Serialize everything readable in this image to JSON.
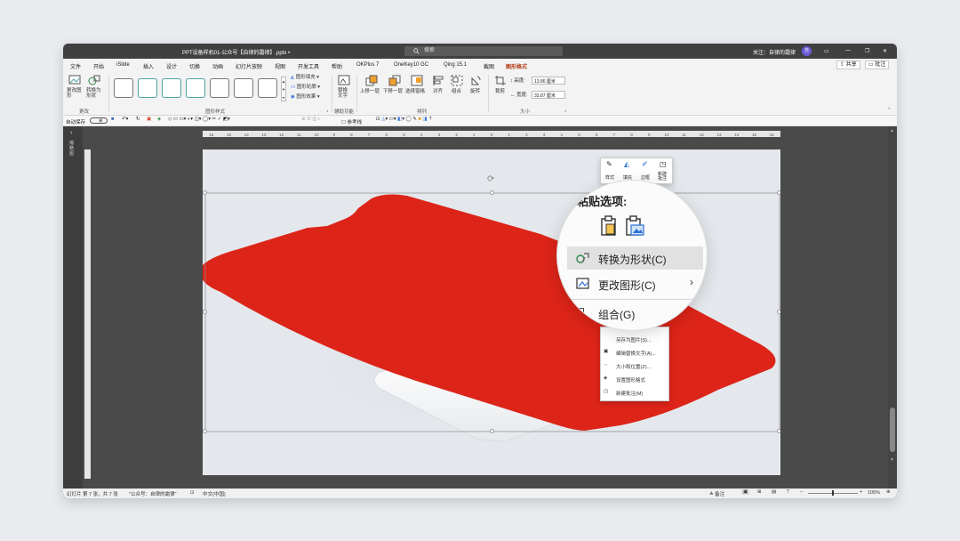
{
  "window": {
    "title": "PPT设备样机01-公众号【自律的霜律】.pptx  •",
    "search_placeholder": "搜索",
    "follow_text": "关注：自律的霜律",
    "avatar_text": "自"
  },
  "menu": {
    "items": [
      "文件",
      "开始",
      "iSlide",
      "插入",
      "设计",
      "切换",
      "动画",
      "幻灯片放映",
      "视图",
      "开发工具",
      "帮助",
      "OKPlus 7",
      "OneKey10 GC",
      "Qing 15.1",
      "截图",
      "图形格式"
    ],
    "share_label": "共享",
    "comment_label": "批注"
  },
  "ribbon": {
    "insert_group": {
      "btn1": "更改图形",
      "btn2": "转换为形状",
      "label": "更改"
    },
    "styles_group": {
      "fill": "图形填充",
      "outline": "图形轮廓",
      "effect": "图形效果",
      "label": "图形样式"
    },
    "access_group": {
      "alt_text": "替换文字",
      "label": "辅助功能"
    },
    "arrange_group": {
      "forward": "上移一层",
      "backward": "下移一层",
      "pane": "选择窗格",
      "align": "对齐",
      "group": "组合",
      "rotate": "旋转",
      "label": "排列"
    },
    "size_group": {
      "crop": "裁剪",
      "height_label": "高度:",
      "height_value": "13.86 厘米",
      "width_label": "宽度:",
      "width_value": "33.87 厘米",
      "label": "大小"
    }
  },
  "qat": {
    "autosave": "自动保存",
    "autosave_state": "关",
    "ref_label": "参考线"
  },
  "rulers": {
    "h_ticks": [
      "16",
      "15",
      "14",
      "13",
      "12",
      "11",
      "10",
      "9",
      "8",
      "7",
      "6",
      "5",
      "4",
      "3",
      "2",
      "1",
      "0",
      "1",
      "2",
      "3",
      "4",
      "5",
      "6",
      "7",
      "8",
      "9",
      "10",
      "11",
      "12",
      "13",
      "14",
      "15",
      "16"
    ]
  },
  "left_pane": {
    "label": "缩略图"
  },
  "mini_toolbar": {
    "style": "样式",
    "fill": "填充",
    "outline": "边框",
    "new_comment": "新建批注"
  },
  "context_menu": {
    "paste_title": "粘贴选项:",
    "convert": "转换为形状(C)",
    "change_shape": "更改图形(C)",
    "group": "组合(G)",
    "save_as_pic": "另存为图片(S)...",
    "edit_alt": "编辑替换文字(A)...",
    "size_pos": "大小和位置(Z)...",
    "format_shape": "设置图形格式",
    "new_comment": "新建批注(M)"
  },
  "status": {
    "slide_info": "幻灯片 第 7 张，共 7 张",
    "notes_owner": "\"公众号：自律的霜律\"",
    "language": "中文(中国)",
    "notes_label": "备注",
    "zoom": "105%"
  },
  "colors": {
    "accent": "#b03a10",
    "red_shape": "#dd2419",
    "teal": "#4aa3a3"
  }
}
